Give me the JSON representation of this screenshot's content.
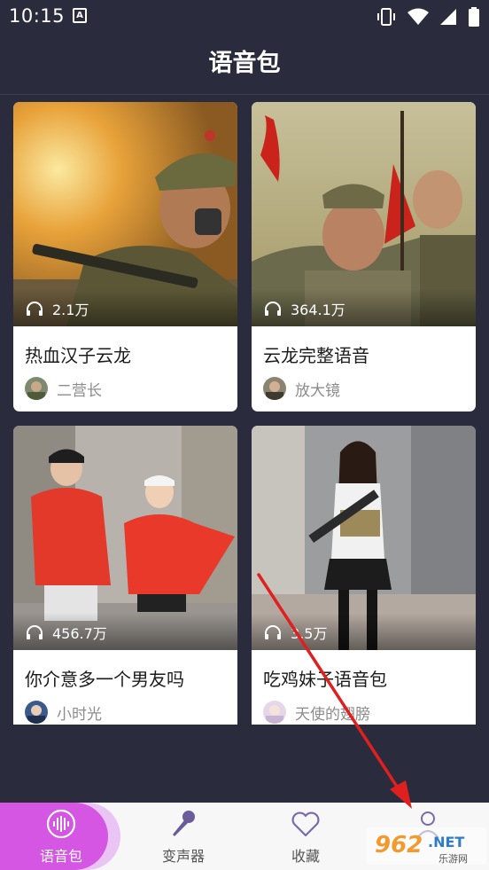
{
  "status_bar": {
    "time": "10:15",
    "notif_icon": "A"
  },
  "header": {
    "title": "语音包"
  },
  "cards": [
    {
      "title": "热血汉子云龙",
      "plays": "2.1万",
      "author": "二营长"
    },
    {
      "title": "云龙完整语音",
      "plays": "364.1万",
      "author": "放大镜"
    },
    {
      "title": "你介意多一个男友吗",
      "plays": "456.7万",
      "author": "小时光"
    },
    {
      "title": "吃鸡妹子语音包",
      "plays": "3.5万",
      "author": "天使的翅膀"
    }
  ],
  "nav": {
    "items": [
      {
        "label": "语音包",
        "icon": "voice-wave-icon"
      },
      {
        "label": "变声器",
        "icon": "microphone-icon"
      },
      {
        "label": "收藏",
        "icon": "heart-icon"
      },
      {
        "label": "",
        "icon": "user-icon"
      }
    ]
  },
  "watermark": {
    "main": "962",
    "suffix": ".NET",
    "sub": "乐游网"
  },
  "colors": {
    "background": "#2a2c3d",
    "accent": "#d456e3",
    "accent_light": "#e9c4f5",
    "annotation_arrow": "#e0201f"
  }
}
